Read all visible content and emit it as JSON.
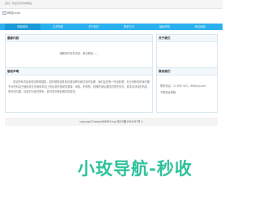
{
  "topbar": {
    "text": "您好！欢迎您访问本网站。"
  },
  "logo": {
    "text": "网站Logo"
  },
  "nav": {
    "items": [
      {
        "label": "网站首页"
      },
      {
        "label": "文章列表"
      },
      {
        "label": "关于我们"
      },
      {
        "label": "联系方式"
      },
      {
        "label": "隐私声明"
      },
      {
        "label": "网站地图"
      }
    ]
  },
  "main": {
    "recommend_title": "最新内容",
    "recommend_empty": "抱歉暂时没有内容，敬请期待……",
    "about_title": "关于我们",
    "statement_title": "版权声明",
    "statement_text": "本站所有内容来源互联网搜集，如有侵权或其他问题请联系我们及时处理，我们会在第一时间处理。无论何种情形我们都不对任何由于使用或无法使用本站上的信息所造成的直接、间接、附带的、特殊的或后果性的损失负责。若本站涉及的内容有任何问题，请及时与我们联系，我们将尽快处理并回复您。",
    "contact_title": "联系我们",
    "contact_tel": "联系电话：22 895 941，88@qq.com",
    "contact_address": "不限地址邮箱"
  },
  "footer": {
    "text": "copyright©www.666895.top  粤ICP备1564187号-1"
  },
  "watermark": {
    "text": "小玫导航-秒收",
    "sub": ""
  }
}
